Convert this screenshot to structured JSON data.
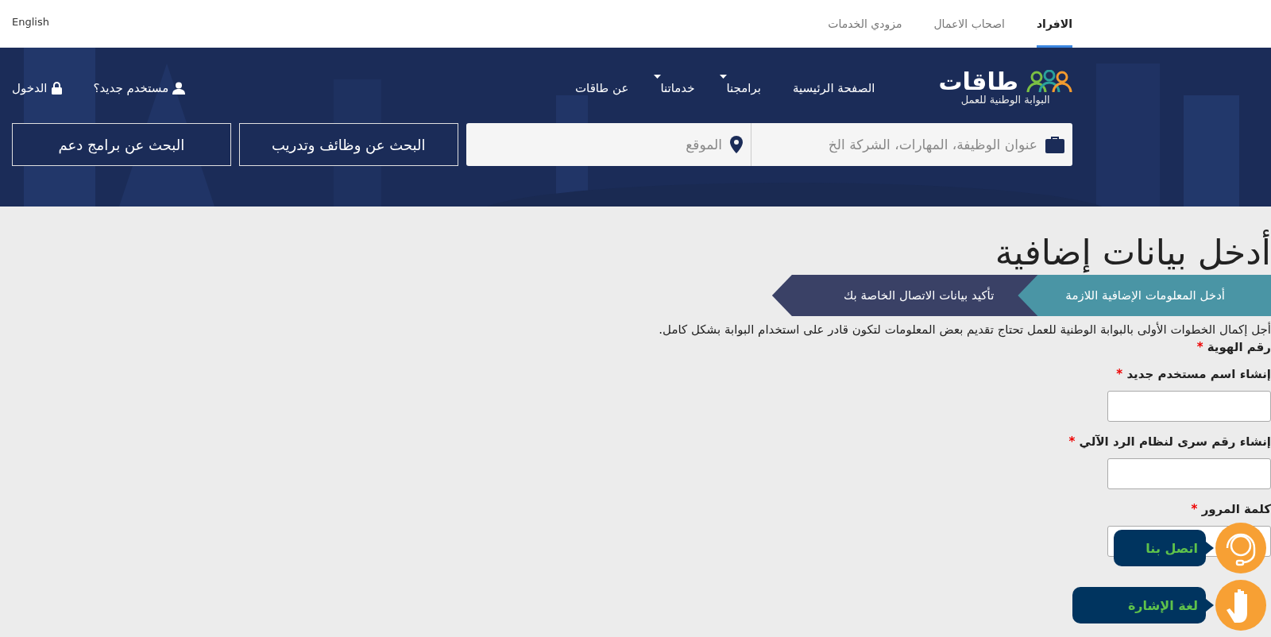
{
  "top_bar": {
    "language_link": "English",
    "audience_tabs": [
      {
        "label": "الافراد",
        "selected": true
      },
      {
        "label": "اصحاب الاعمال",
        "selected": false
      },
      {
        "label": "مزودي الخدمات",
        "selected": false
      }
    ]
  },
  "header": {
    "logo": {
      "name": "طاقات",
      "tagline": "البوابة الوطنية للعمل"
    },
    "nav": [
      {
        "label": "الصفحة الرئيسية",
        "dropdown": false
      },
      {
        "label": "برامجنا",
        "dropdown": true
      },
      {
        "label": "خدماتنا",
        "dropdown": true
      },
      {
        "label": "عن طاقات",
        "dropdown": false
      }
    ],
    "account": [
      {
        "label": "مستخدم جديد؟",
        "kind": "user"
      },
      {
        "label": "الدخول",
        "kind": "lock"
      }
    ],
    "search": {
      "job_placeholder": "عنوان الوظيفة، المهارات، الشركة الخ",
      "location_placeholder": "الموقع",
      "buttons": [
        "البحث عن وظائف وتدريب",
        "البحث عن برامج دعم"
      ]
    }
  },
  "page": {
    "title": "أدخل بيانات إضافية",
    "steps": [
      {
        "label": "أدخل المعلومات الإضافية اللازمة",
        "selected": true
      },
      {
        "label": "تأكيد بيانات الاتصال الخاصة بك",
        "selected": false
      }
    ],
    "intro": "أجل إكمال الخطوات الأولى بالبوابة الوطنية للعمل تحتاج تقديم بعض المعلومات لتكون قادر على استخدام البوابة بشكل كامل.",
    "fields": [
      {
        "label": "رقم الهوية",
        "required_mark": "*",
        "kind": "text"
      },
      {
        "label": "إنشاء اسم مستخدم جديد",
        "required_mark": "*",
        "kind": "input"
      },
      {
        "label": "إنشاء رقم سرى لنظام الرد الآلي",
        "required_mark": "*",
        "kind": "input"
      },
      {
        "label": "كلمة المرور",
        "required_mark": "*",
        "kind": "input"
      }
    ]
  },
  "help_widgets": [
    {
      "label": "اتصل بنا",
      "kind": "headset"
    },
    {
      "label": "لغة الإشارة",
      "kind": "hand"
    }
  ]
}
